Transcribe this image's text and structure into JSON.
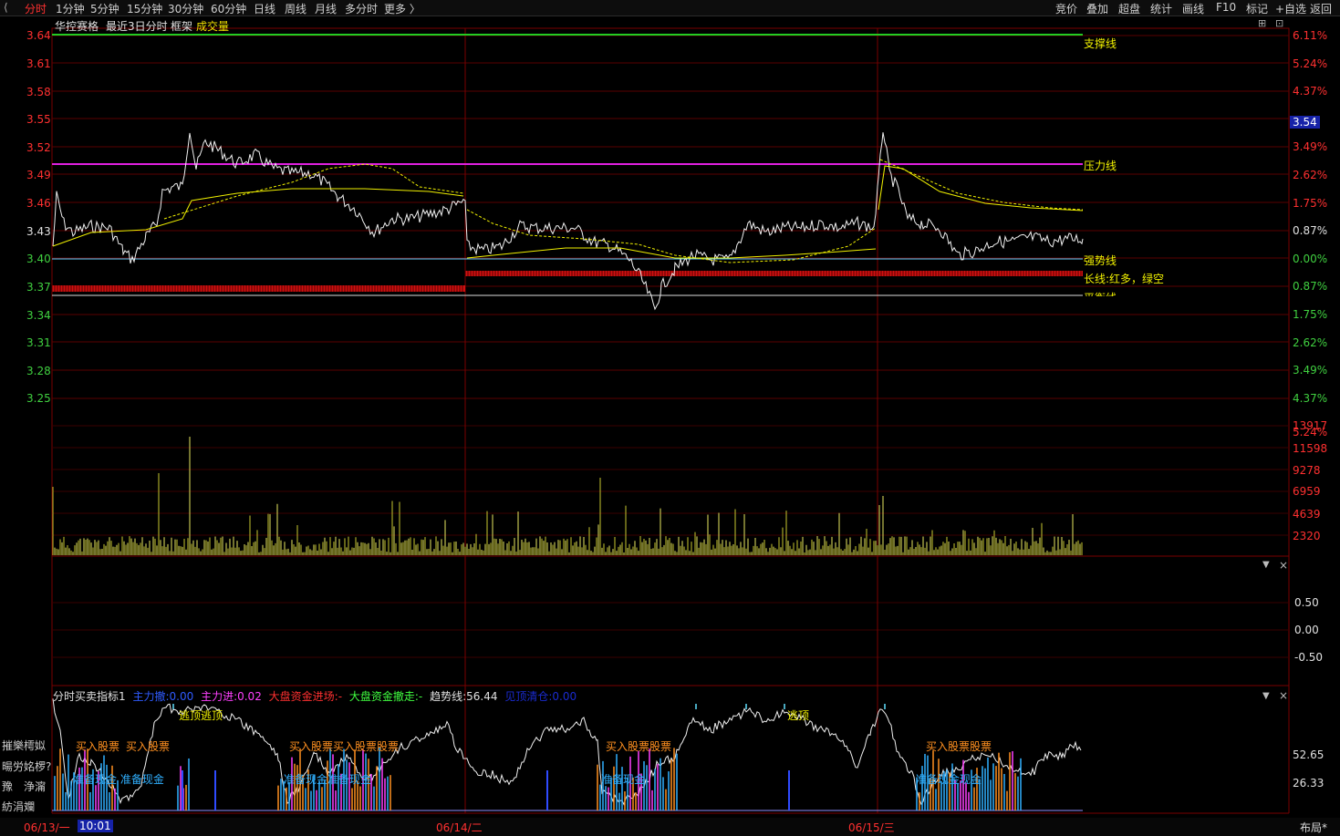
{
  "toolbar": {
    "back_icon": "back-icon",
    "periods": [
      "分时",
      "1分钟",
      "5分钟",
      "15分钟",
      "30分钟",
      "60分钟",
      "日线",
      "周线",
      "月线",
      "多分时",
      "更多 〉"
    ],
    "active": "分时",
    "right_menu": [
      "竞价",
      "叠加",
      "超盘",
      "统计",
      "画线",
      "F10",
      "标记",
      "+自选",
      "返回"
    ]
  },
  "main_header": {
    "stock": "华控赛格",
    "range": "最近3日分时",
    "frame": "框架",
    "indicator": "成交量"
  },
  "price_axis": [
    "3.64",
    "3.61",
    "3.58",
    "3.55",
    "3.52",
    "3.49",
    "3.46",
    "3.43",
    "3.40",
    "3.37",
    "3.34",
    "3.31",
    "3.28",
    "3.25"
  ],
  "pct_axis": [
    "6.11%",
    "5.24%",
    "4.37%",
    "3.49%",
    "2.62%",
    "1.75%",
    "0.87%",
    "0.00%",
    "0.87%",
    "1.75%",
    "2.62%",
    "3.49%",
    "4.37%",
    "5.24%"
  ],
  "current_price": "3.54",
  "line_labels": {
    "support": "支撑线",
    "pressure": "压力线",
    "strong": "强势线",
    "longline": "长线:红多，绿空",
    "balance": "平衡线"
  },
  "volume_axis": [
    "13917",
    "11598",
    "9278",
    "6959",
    "4639",
    "2320"
  ],
  "sub1_axis": [
    "0.50",
    "0.00",
    "-0.50"
  ],
  "sub2_header": {
    "name": "分时买卖指标1",
    "items": [
      {
        "label": "主力撤:",
        "value": "0.00",
        "color": "#2f5bff"
      },
      {
        "label": "主力进:",
        "value": "0.02",
        "color": "#ff40ff"
      },
      {
        "label": "大盘资金进场:",
        "value": "-",
        "color": "#ff3030"
      },
      {
        "label": "大盘资金撤走:",
        "value": "-",
        "color": "#40ff40"
      },
      {
        "label": "趋势线:",
        "value": "56.44",
        "color": "#e0e0e0"
      },
      {
        "label": "见顶清仓:",
        "value": "0.00",
        "color": "#1a2bd0"
      }
    ]
  },
  "sub2_axis": [
    "52.65",
    "26.33"
  ],
  "sub2_signals": {
    "buy": [
      "买入股票",
      "买入股票",
      "买入股票买入股票股票",
      "买入股票股票",
      "买入股票股票"
    ],
    "cash": [
      "准备现金 准备现金",
      "准备现金准备现金",
      "准备现金",
      "准备现金现金"
    ],
    "escape": [
      "逃顶逃顶",
      "逃顶"
    ]
  },
  "left_garbled": [
    "摧樂樗姒",
    "暘労姳椤?",
    "豫　浄澝",
    "紡涓斕"
  ],
  "dates": [
    "06/13/一",
    "06/14/二",
    "06/15/三"
  ],
  "cursor_time": "10:01",
  "layout_btn": "布局*",
  "colors": {
    "price": "#ff3030",
    "down": "#40d040",
    "pct_up": "#ff3030",
    "pct_down": "#40d040",
    "support": "#22cc22",
    "pressure": "#e020e0",
    "strong": "#60d0ff",
    "avg": "#f0f000",
    "vol": "#d8d840",
    "grid": "#5a0000"
  }
}
